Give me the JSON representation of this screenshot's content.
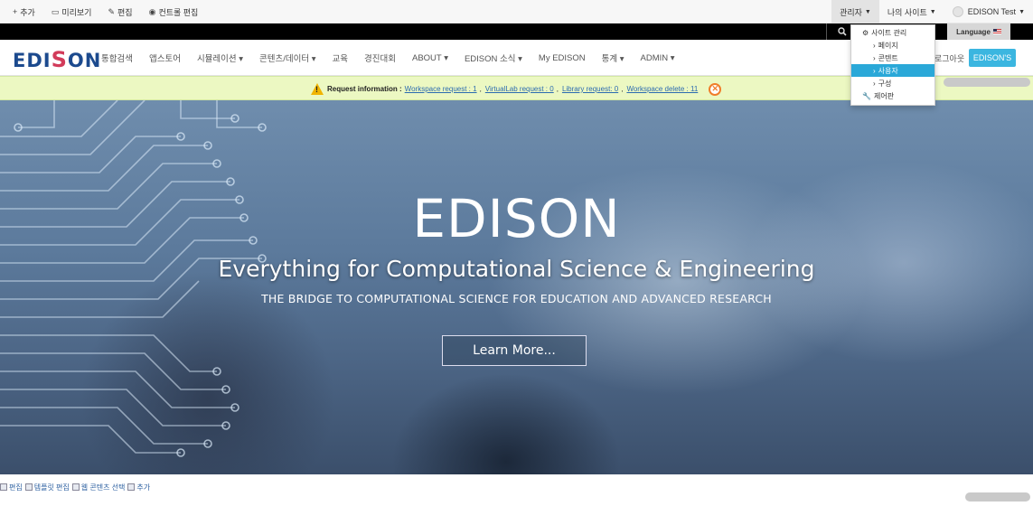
{
  "dockbar": {
    "left": [
      {
        "icon": "+",
        "label": "추가"
      },
      {
        "icon": "▭",
        "label": "미리보기"
      },
      {
        "icon": "✎",
        "label": "편집"
      },
      {
        "icon": "◉",
        "label": "컨트롤 편집"
      }
    ],
    "admin_label": "관리자",
    "mysite_label": "나의 사이트",
    "user_label": "EDISON Test"
  },
  "language_label": "Language",
  "logo": {
    "text_before": "EDI",
    "text_s": "S",
    "text_after": "ON"
  },
  "nav": {
    "items": [
      "통합검색",
      "앱스토어",
      "시뮬레이션 ▾",
      "콘텐츠/데이터 ▾",
      "교육",
      "경진대회",
      "ABOUT ▾",
      "EDISON 소식 ▾",
      "My EDISON",
      "통계 ▾",
      "ADMIN ▾"
    ],
    "logout_label": "로그아웃",
    "edisons_label": "EDISON'S"
  },
  "request": {
    "label": "Request information :",
    "links": [
      "Workspace request : 1",
      "VirtualLab request : 0",
      "Library request: 0",
      "Workspace delete : 11"
    ],
    "close_symbol": "✕"
  },
  "hero": {
    "title": "EDISON",
    "subtitle": "Everything for Computational Science & Engineering",
    "tagline": "THE BRIDGE TO COMPUTATIONAL SCIENCE FOR EDUCATION AND ADVANCED RESEARCH",
    "button": "Learn More..."
  },
  "bottom_edit": [
    "편집",
    "템플릿 편집",
    "웹 콘텐츠 선택",
    "추가"
  ],
  "admin_dropdown": {
    "items": [
      {
        "label": "사이트 관리",
        "icon": "⚙",
        "sub": false,
        "active": false
      },
      {
        "label": "페이지",
        "icon": "›",
        "sub": true,
        "active": false
      },
      {
        "label": "콘텐트",
        "icon": "›",
        "sub": true,
        "active": false
      },
      {
        "label": "사용자",
        "icon": "›",
        "sub": true,
        "active": true
      },
      {
        "label": "구성",
        "icon": "›",
        "sub": true,
        "active": false
      },
      {
        "label": "제어판",
        "icon": "🔧",
        "sub": false,
        "active": false
      }
    ]
  }
}
